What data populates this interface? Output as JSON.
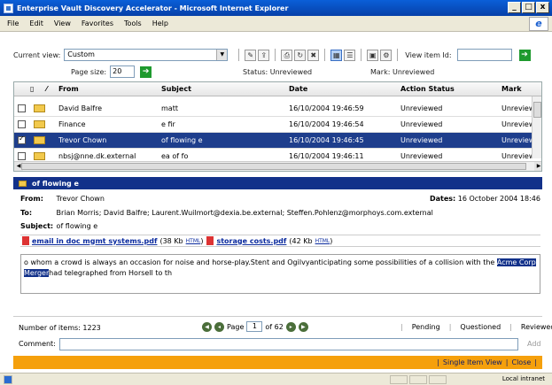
{
  "window": {
    "title": "Enterprise Vault Discovery Accelerator - Microsoft Internet Explorer",
    "min": "_",
    "max": "□",
    "close": "x"
  },
  "menu": [
    "File",
    "Edit",
    "View",
    "Favorites",
    "Tools",
    "Help"
  ],
  "toolbar": {
    "current_view_label": "Current view:",
    "current_view_value": "Custom",
    "view_item_label": "View item Id:",
    "page_size_label": "Page size:",
    "page_size_value": "20",
    "status_text": "Status: Unreviewed",
    "mark_text": "Mark:    Unreviewed"
  },
  "grid": {
    "columns": [
      "From",
      "Subject",
      "Date",
      "Action Status",
      "Mark"
    ],
    "rows": [
      {
        "from": "David Balfre",
        "subject": "matt",
        "date": "16/10/2004 19:46:59",
        "status": "Unreviewed",
        "mark": "Unreviewe",
        "checked": false,
        "selected": false
      },
      {
        "from": "Finance",
        "subject": "e fir",
        "date": "16/10/2004 19:46:54",
        "status": "Unreviewed",
        "mark": "Unreviewe",
        "checked": false,
        "selected": false
      },
      {
        "from": "Trevor Chown",
        "subject": "of flowing e",
        "date": "16/10/2004 19:46:45",
        "status": "Unreviewed",
        "mark": "Unreviewe",
        "checked": true,
        "selected": true
      },
      {
        "from": "nbsj@nne.dk.external",
        "subject": "ea of fo",
        "date": "16/10/2004 19:46:11",
        "status": "Unreviewed",
        "mark": "Unreviewe",
        "checked": false,
        "selected": false
      }
    ]
  },
  "preview": {
    "subject_header": "of flowing e",
    "from_label": "From:",
    "from_value": "Trevor Chown",
    "dates_label": "Dates:",
    "dates_value": "16 October 2004 18:46",
    "to_label": "To:",
    "to_value": "Brian Morris; David Balfre; Laurent.Wuilmort@dexia.be.external; Steffen.Pohlenz@morphoys.com.external",
    "subject_label": "Subject:",
    "subject_value": "of flowing e",
    "attachments": [
      {
        "name": "email in doc mgmt systems.pdf",
        "size": "(38 Kb",
        "html": "HTML",
        "close": ")"
      },
      {
        "name": "storage costs.pdf",
        "size": "(42 Kb",
        "html": "HTML",
        "close": ")"
      }
    ],
    "body_before": "o whom a crowd is always an occasion for noise and horse-play.Stent and Ogilvyanticipating some possibilities of a collision with the ",
    "body_highlight": "Acme Corp Merger",
    "body_after": "had telegraphed from Horsell to th"
  },
  "footer": {
    "count": "Number of items: 1223",
    "page_label": "Page",
    "page_value": "1",
    "of_label": "of 62",
    "pending": "Pending",
    "questioned": "Questioned",
    "reviewed": "Reviewed",
    "comment_label": "Comment:",
    "add": "Add",
    "single_item_view": "Single Item View",
    "close": "Close"
  },
  "statusbar": {
    "zone": "Local intranet"
  }
}
